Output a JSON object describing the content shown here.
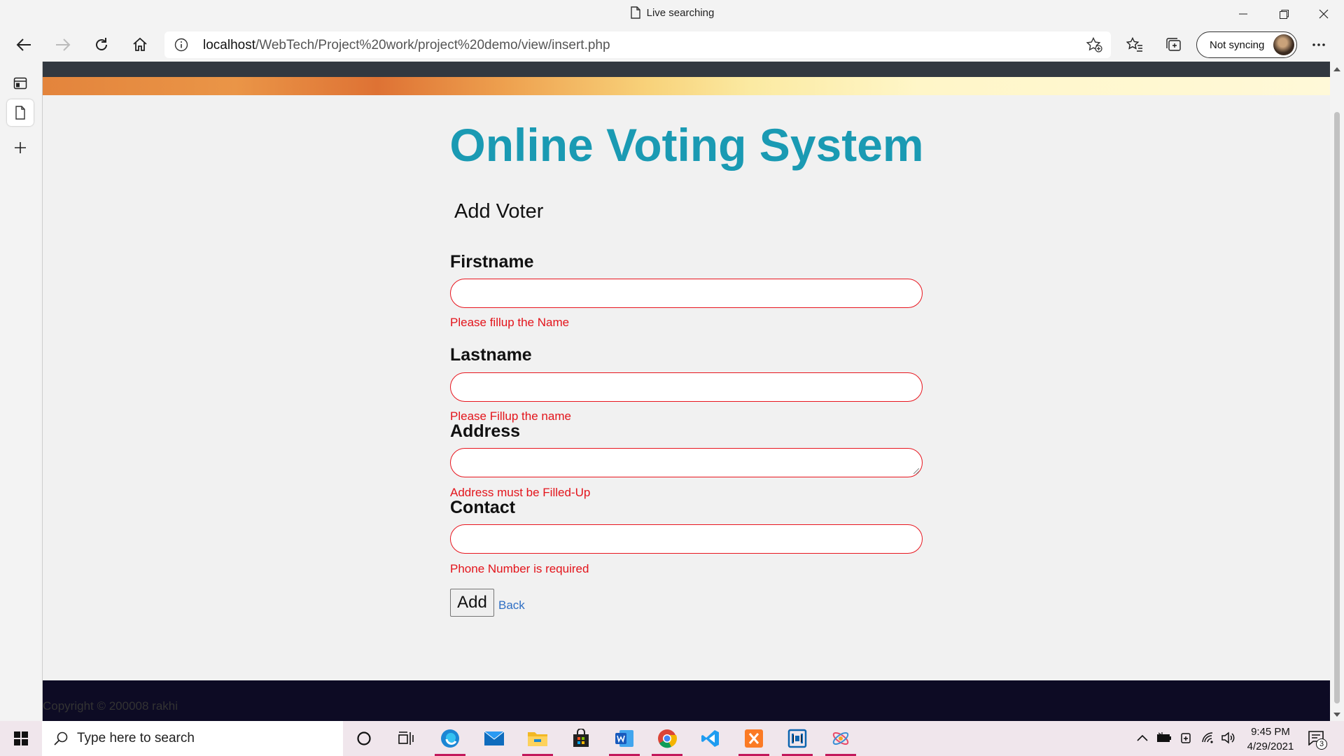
{
  "window": {
    "title": "Live searching"
  },
  "toolbar": {
    "url_host": "localhost",
    "url_path": "/WebTech/Project%20work/project%20demo/view/insert.php",
    "sync_label": "Not syncing"
  },
  "page": {
    "title": "Online Voting System",
    "form_heading": "Add Voter",
    "fields": [
      {
        "label": "Firstname",
        "value": "",
        "error": "Please fillup the Name"
      },
      {
        "label": "Lastname",
        "value": "",
        "error": "Please Fillup the name"
      },
      {
        "label": "Address",
        "value": "",
        "error": "Address must be Filled-Up"
      },
      {
        "label": "Contact",
        "value": "",
        "error": "Phone Number is required"
      }
    ],
    "add_label": "Add",
    "back_label": "Back",
    "footer": "Copyright © 200008 rakhi"
  },
  "taskbar": {
    "search_placeholder": "Type here to search",
    "time": "9:45 PM",
    "date": "4/29/2021",
    "notification_count": "3",
    "apps": [
      "cortana-icon",
      "task-view-icon",
      "edge-icon",
      "mail-icon",
      "file-explorer-icon",
      "store-icon",
      "word-icon",
      "chrome-icon",
      "vscode-icon",
      "xampp-icon",
      "snipping-tool-icon",
      "paint-3d-icon"
    ]
  },
  "colors": {
    "title": "#1a9ab3",
    "error": "#e3141b",
    "link": "#2f6fc4",
    "footer": "#0d0b24"
  }
}
